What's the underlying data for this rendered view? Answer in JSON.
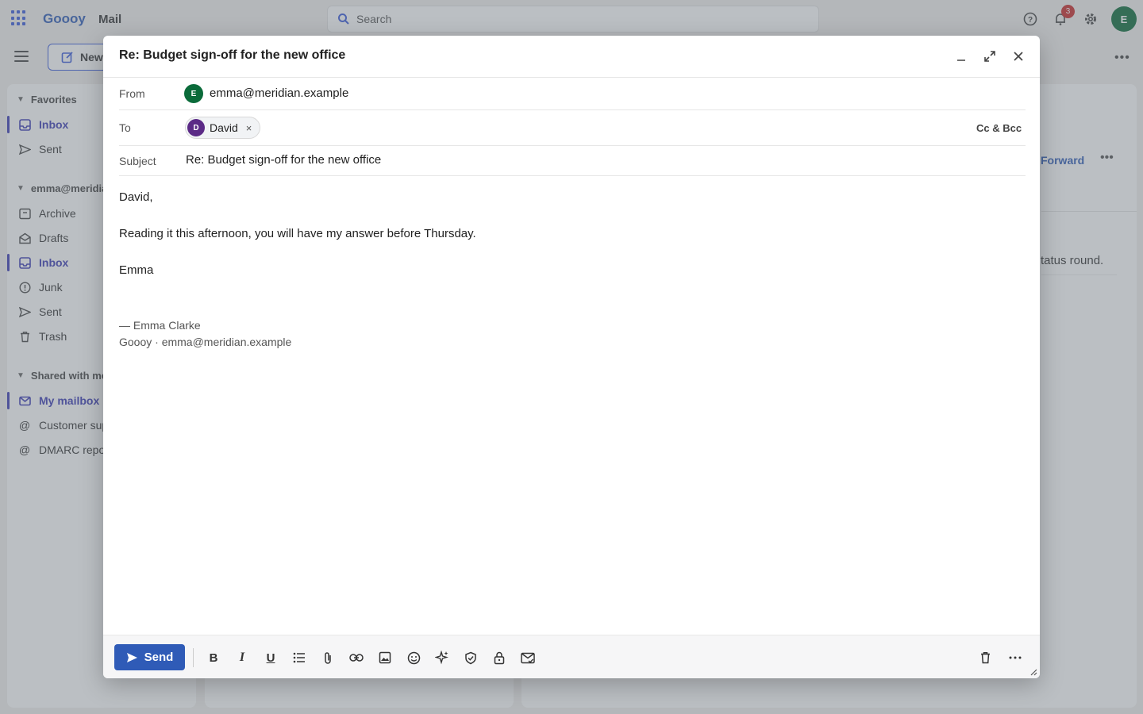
{
  "app": {
    "brand": "Goooy",
    "product": "Mail",
    "search_placeholder": "Search",
    "notification_count": "3",
    "user_initial": "E",
    "new_button_label": "New",
    "accent_color": "#2f5bb7"
  },
  "sidebar": {
    "favorites_label": "Favorites",
    "favorites": [
      {
        "label": "Inbox",
        "icon": "inbox-icon",
        "active": true
      },
      {
        "label": "Sent",
        "icon": "send-icon",
        "active": false
      }
    ],
    "account_label": "emma@meridian.example",
    "account_items": [
      {
        "label": "Archive",
        "icon": "archive-icon"
      },
      {
        "label": "Drafts",
        "icon": "drafts-icon"
      },
      {
        "label": "Inbox",
        "icon": "inbox-icon",
        "active": true
      },
      {
        "label": "Junk",
        "icon": "junk-icon"
      },
      {
        "label": "Sent",
        "icon": "send-icon"
      },
      {
        "label": "Trash",
        "icon": "trash-icon"
      }
    ],
    "shared_label": "Shared with me",
    "shared_items": [
      {
        "label": "My mailbox",
        "icon": "mail-icon",
        "active": true
      },
      {
        "label": "Customer support",
        "icon": "at-icon"
      },
      {
        "label": "DMARC reports",
        "icon": "at-icon"
      }
    ]
  },
  "reading_pane": {
    "forward_label": "Forward",
    "visible_text": "tatus round."
  },
  "compose": {
    "title": "Re: Budget sign-off for the new office",
    "from_label": "From",
    "from_initial": "E",
    "from_value": "emma@meridian.example",
    "to_label": "To",
    "to_recipients": [
      {
        "initial": "D",
        "name": "David",
        "avatar_color": "#5b2a86"
      }
    ],
    "cc_bcc_label": "Cc & Bcc",
    "subject_label": "Subject",
    "subject_value": "Re: Budget sign-off for the new office",
    "body_lines": [
      "David,",
      "Reading it this afternoon, you will have my answer before Thursday.",
      "Emma"
    ],
    "signature_lines": [
      "— Emma Clarke",
      "Goooy · emma@meridian.example"
    ],
    "send_label": "Send",
    "toolbar_icons": [
      "bold-icon",
      "italic-icon",
      "underline-icon",
      "list-icon",
      "attach-icon",
      "link-icon",
      "image-icon",
      "emoji-icon",
      "sparkle-icon",
      "shield-check-icon",
      "lock-icon",
      "mail-receipt-icon",
      "trash-icon",
      "more-icon"
    ]
  }
}
